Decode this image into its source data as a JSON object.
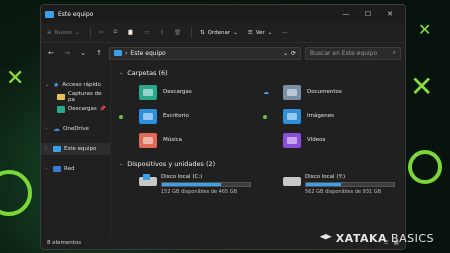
{
  "window": {
    "title": "Este equipo",
    "controls": [
      "minimize-icon",
      "maximize-icon",
      "close-icon"
    ]
  },
  "commandbar": {
    "new_label": "Nuevo",
    "sort_label": "Ordenar",
    "view_label": "Ver",
    "more_label": "···"
  },
  "address": {
    "path": "Este equipo",
    "search_placeholder": "Buscar en Este equipo"
  },
  "sidebar": {
    "quick_access": "Acceso rápido",
    "items": [
      {
        "label": "Capturas de pa"
      },
      {
        "label": "Descargas"
      }
    ],
    "onedrive": "OneDrive",
    "this_pc": "Este equipo",
    "network": "Red"
  },
  "folders_group": {
    "title": "Carpetas (6)",
    "items": [
      {
        "label": "Descargas",
        "color": "#2aa88d"
      },
      {
        "label": "Documentos",
        "color": "#7a8fa8"
      },
      {
        "label": "Escritorio",
        "color": "#2b8fe0"
      },
      {
        "label": "Imágenes",
        "color": "#2f8fd6"
      },
      {
        "label": "Música",
        "color": "#e06a55"
      },
      {
        "label": "Vídeos",
        "color": "#8a4fd8"
      }
    ]
  },
  "drives_group": {
    "title": "Dispositivos y unidades (2)",
    "items": [
      {
        "name": "Disco local (C:)",
        "free": "152 GB disponibles de 465 GB",
        "used_fraction": 0.67
      },
      {
        "name": "Disco local (Y:)",
        "free": "562 GB disponibles de 931 GB",
        "used_fraction": 0.4
      }
    ]
  },
  "status": {
    "count": "8 elementos"
  },
  "watermark": {
    "brand": "XATAKA",
    "sub": "BASICS"
  }
}
